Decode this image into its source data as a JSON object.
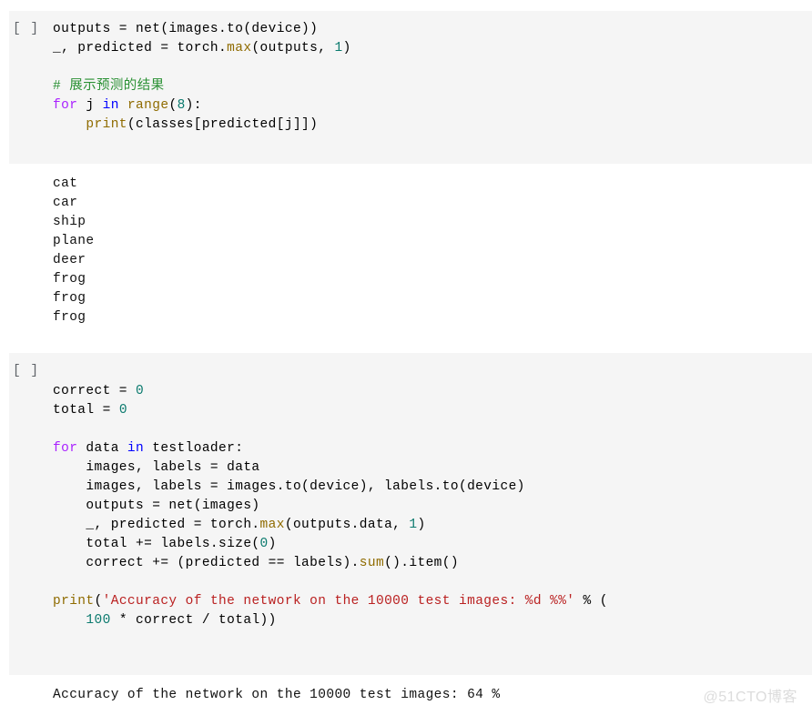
{
  "notebook": {
    "background_color": "#ffffff",
    "cell_background_color": "#f5f5f5",
    "prompt_color": "#5f6368",
    "watermark": "@51CTO博客",
    "colors": {
      "keyword": "#aa22ff",
      "operator_keyword": "#0000ff",
      "builtin_function": "#8f6b00",
      "number": "#0b7a6e",
      "string": "#ba2121",
      "comment": "#2a9134",
      "plain": "#000000"
    }
  },
  "cells": [
    {
      "prompt": "[ ]",
      "code_lines": [
        [
          {
            "t": "outputs = net(images.to(device))",
            "c": "plain"
          }
        ],
        [
          {
            "t": "_, predicted = torch.",
            "c": "plain"
          },
          {
            "t": "max",
            "c": "fn"
          },
          {
            "t": "(outputs, ",
            "c": "plain"
          },
          {
            "t": "1",
            "c": "num"
          },
          {
            "t": ")",
            "c": "plain"
          }
        ],
        [
          {
            "t": "",
            "c": "plain"
          }
        ],
        [
          {
            "t": "# 展示预测的结果",
            "c": "com"
          }
        ],
        [
          {
            "t": "for",
            "c": "kw"
          },
          {
            "t": " j ",
            "c": "plain"
          },
          {
            "t": "in",
            "c": "op-kw"
          },
          {
            "t": " ",
            "c": "plain"
          },
          {
            "t": "range",
            "c": "fn"
          },
          {
            "t": "(",
            "c": "plain"
          },
          {
            "t": "8",
            "c": "num"
          },
          {
            "t": "):",
            "c": "plain"
          }
        ],
        [
          {
            "t": "    ",
            "c": "plain"
          },
          {
            "t": "print",
            "c": "fn"
          },
          {
            "t": "(classes[predicted[j]])",
            "c": "plain"
          }
        ]
      ],
      "output_lines": [
        "cat",
        "car",
        "ship",
        "plane",
        "deer",
        "frog",
        "frog",
        "frog"
      ]
    },
    {
      "prompt": "[ ]",
      "code_lines": [
        [
          {
            "t": "correct = ",
            "c": "plain"
          },
          {
            "t": "0",
            "c": "num"
          }
        ],
        [
          {
            "t": "total = ",
            "c": "plain"
          },
          {
            "t": "0",
            "c": "num"
          }
        ],
        [
          {
            "t": "",
            "c": "plain"
          }
        ],
        [
          {
            "t": "for",
            "c": "kw"
          },
          {
            "t": " data ",
            "c": "plain"
          },
          {
            "t": "in",
            "c": "op-kw"
          },
          {
            "t": " testloader:",
            "c": "plain"
          }
        ],
        [
          {
            "t": "    images, labels = data",
            "c": "plain"
          }
        ],
        [
          {
            "t": "    images, labels = images.to(device), labels.to(device)",
            "c": "plain"
          }
        ],
        [
          {
            "t": "    outputs = net(images)",
            "c": "plain"
          }
        ],
        [
          {
            "t": "    _, predicted = torch.",
            "c": "plain"
          },
          {
            "t": "max",
            "c": "fn"
          },
          {
            "t": "(outputs.data, ",
            "c": "plain"
          },
          {
            "t": "1",
            "c": "num"
          },
          {
            "t": ")",
            "c": "plain"
          }
        ],
        [
          {
            "t": "    total += labels.size(",
            "c": "plain"
          },
          {
            "t": "0",
            "c": "num"
          },
          {
            "t": ")",
            "c": "plain"
          }
        ],
        [
          {
            "t": "    correct += (predicted == labels).",
            "c": "plain"
          },
          {
            "t": "sum",
            "c": "fn"
          },
          {
            "t": "().item()",
            "c": "plain"
          }
        ],
        [
          {
            "t": "",
            "c": "plain"
          }
        ],
        [
          {
            "t": "print",
            "c": "fn"
          },
          {
            "t": "(",
            "c": "plain"
          },
          {
            "t": "'Accuracy of the network on the 10000 test images: %d %%'",
            "c": "str"
          },
          {
            "t": " % (",
            "c": "plain"
          }
        ],
        [
          {
            "t": "    ",
            "c": "plain"
          },
          {
            "t": "100",
            "c": "num"
          },
          {
            "t": " * correct / total))",
            "c": "plain"
          }
        ]
      ],
      "output_lines": [
        "Accuracy of the network on the 10000 test images: 64 %"
      ]
    }
  ]
}
